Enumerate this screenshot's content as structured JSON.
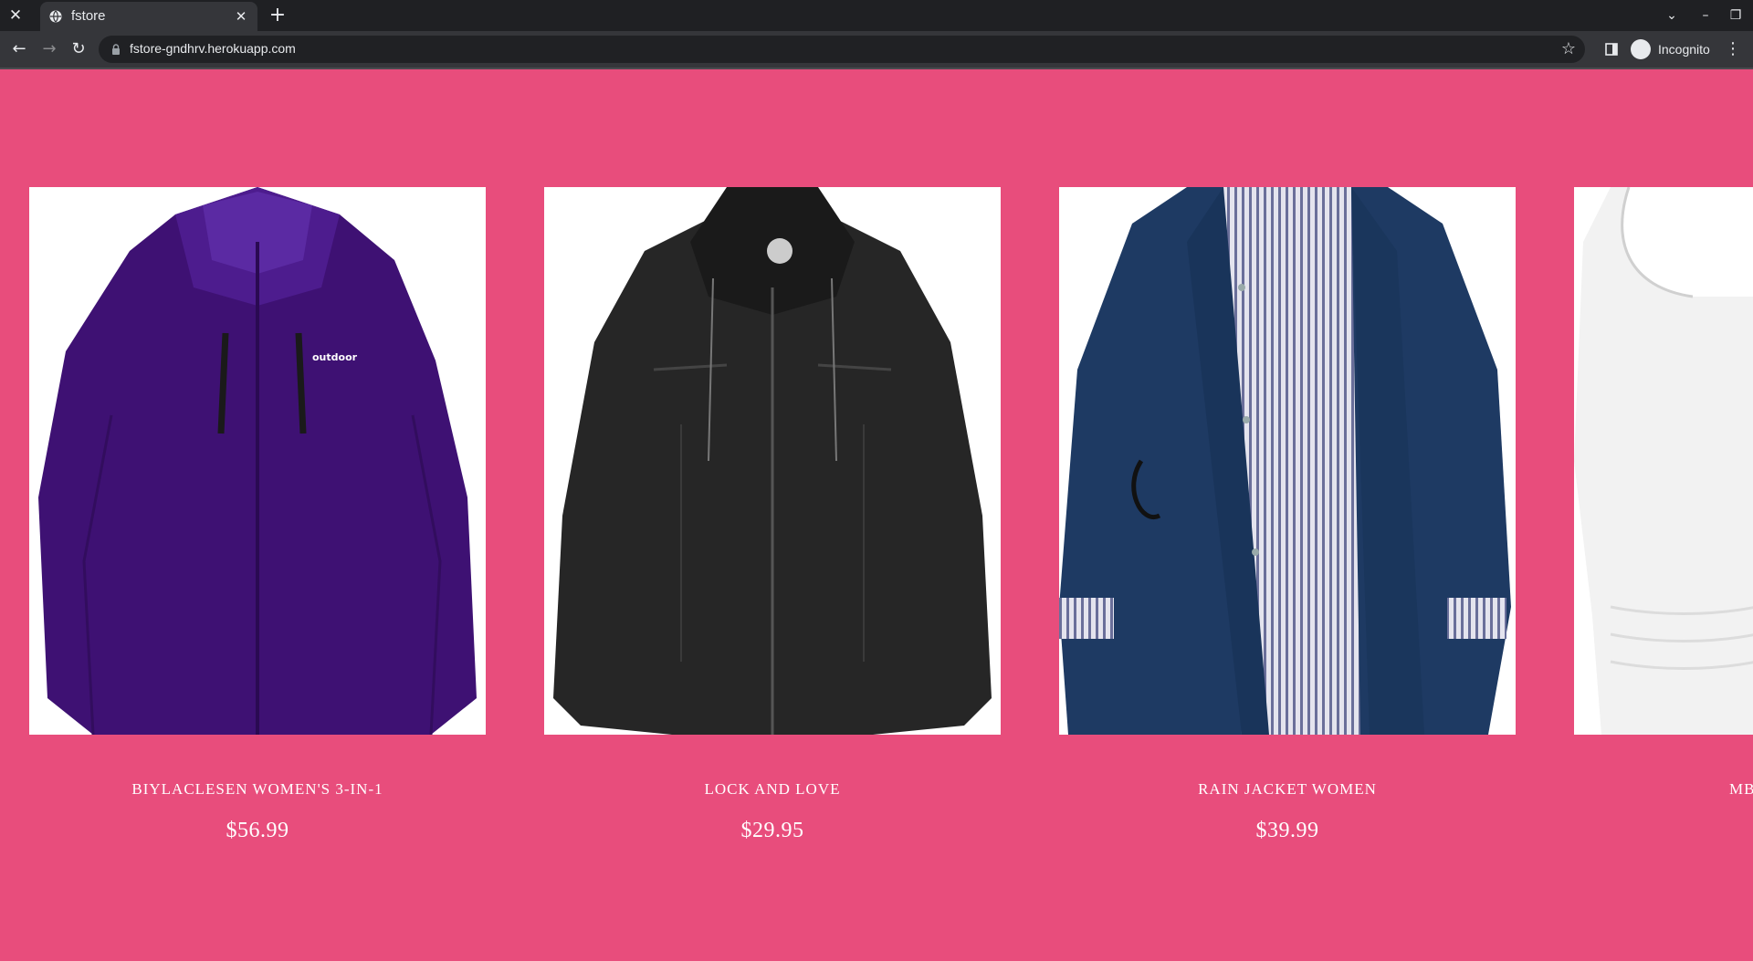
{
  "browser": {
    "tab_title": "fstore",
    "url": "fstore-gndhrv.herokuapp.com",
    "profile_label": "Incognito"
  },
  "products": [
    {
      "title": "BIYLACLESEN WOMEN'S 3-IN-1",
      "price": "$56.99",
      "image": "purple-jacket"
    },
    {
      "title": "LOCK AND LOVE",
      "price": "$29.95",
      "image": "black-leather-jacket"
    },
    {
      "title": "RAIN JACKET WOMEN",
      "price": "$39.99",
      "image": "navy-rain-jacket"
    },
    {
      "title": "MBJ",
      "price": "",
      "image": "white-top"
    }
  ],
  "colors": {
    "page_background": "#e84d7c",
    "text": "#ffffff"
  }
}
